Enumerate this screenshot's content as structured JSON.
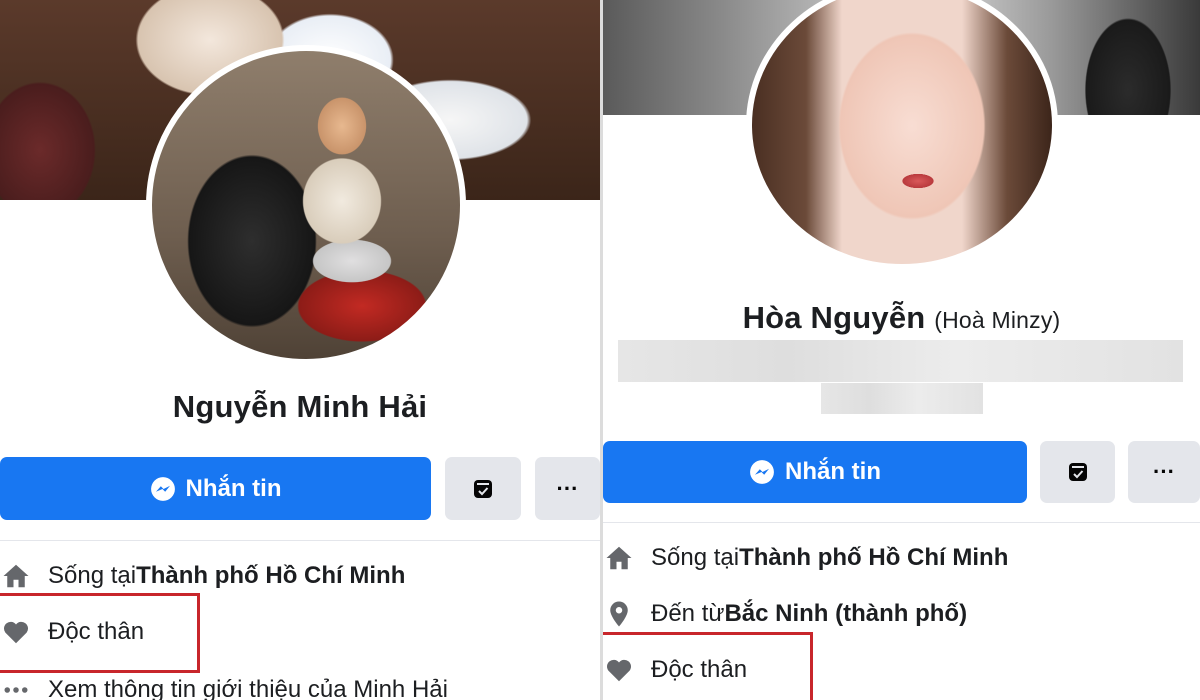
{
  "left_profile": {
    "name": "Nguyễn Minh Hải",
    "message_button": "Nhắn tin",
    "more_button": "···",
    "info": [
      {
        "prefix": "Sống tại ",
        "bold": "Thành phố Hồ Chí Minh",
        "icon": "home-icon"
      },
      {
        "prefix": "Độc thân",
        "bold": "",
        "icon": "heart-icon"
      },
      {
        "prefix": "Xem thông tin giới thiệu của Minh Hải",
        "bold": "",
        "icon": "more-icon"
      }
    ]
  },
  "right_profile": {
    "name": "Hòa Nguyễn",
    "alt_name": "(Hoà Minzy)",
    "message_button": "Nhắn tin",
    "more_button": "···",
    "info": [
      {
        "prefix": "Sống tại ",
        "bold": "Thành phố Hồ Chí Minh",
        "icon": "home-icon"
      },
      {
        "prefix": "Đến từ ",
        "bold": "Bắc Ninh (thành phố)",
        "icon": "location-pin-icon"
      },
      {
        "prefix": "Độc thân",
        "bold": "",
        "icon": "heart-icon"
      }
    ]
  },
  "colors": {
    "primary": "#1877f2",
    "secondary_button": "#e4e6eb",
    "highlight": "#c8262b",
    "icon": "#65676b"
  }
}
